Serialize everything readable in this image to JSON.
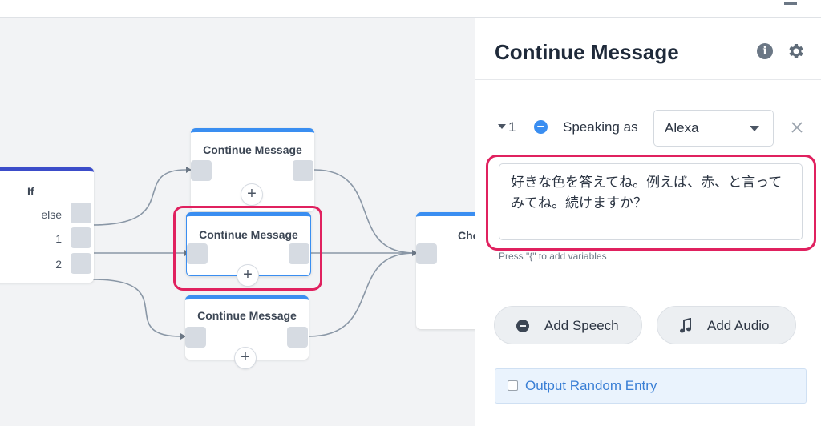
{
  "canvas": {
    "if_block": {
      "title": "If",
      "outputs": [
        "else",
        "1",
        "2"
      ]
    },
    "blocks": [
      {
        "title": "Continue Message"
      },
      {
        "title": "Continue Message"
      },
      {
        "title": "Continue Message"
      }
    ],
    "partial_block": {
      "title": "Cho"
    },
    "add_symbol": "+"
  },
  "panel": {
    "title": "Continue Message",
    "info_symbol": "i",
    "step": {
      "number": "1",
      "speaking_label": "Speaking as",
      "voice": "Alexa",
      "text": "好きな色を答えてね。例えば、赤、と言ってみてね。続けますか？"
    },
    "hint": "Press \"{\" to add variables",
    "buttons": {
      "add_speech": "Add Speech",
      "add_audio": "Add Audio"
    },
    "output_random_entry": "Output Random Entry"
  },
  "colors": {
    "accent_blue": "#3a8ef1",
    "if_header": "#3b4cc9",
    "highlight": "#e0215f",
    "link_blue": "#3a7fd5"
  }
}
